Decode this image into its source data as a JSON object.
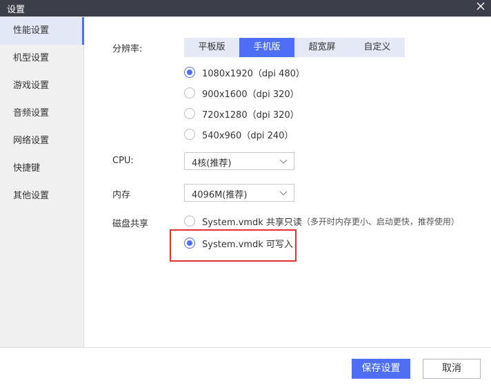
{
  "window": {
    "title": "设置"
  },
  "sidebar": {
    "items": [
      {
        "label": "性能设置",
        "active": true
      },
      {
        "label": "机型设置"
      },
      {
        "label": "游戏设置"
      },
      {
        "label": "音频设置"
      },
      {
        "label": "网络设置"
      },
      {
        "label": "快捷键"
      },
      {
        "label": "其他设置"
      }
    ]
  },
  "resolution": {
    "label": "分辨率:",
    "tabs": [
      {
        "label": "平板版"
      },
      {
        "label": "手机版",
        "active": true
      },
      {
        "label": "超宽屏"
      },
      {
        "label": "自定义"
      }
    ],
    "options": [
      {
        "label": "1080x1920（dpi 480）",
        "checked": true
      },
      {
        "label": "900x1600（dpi 320）"
      },
      {
        "label": "720x1280（dpi 320）"
      },
      {
        "label": "540x960（dpi 240）"
      }
    ]
  },
  "cpu": {
    "label": "CPU:",
    "value": "4核(推荐)"
  },
  "memory": {
    "label": "内存",
    "value": "4096M(推荐)"
  },
  "disk": {
    "label": "磁盘共享",
    "options": [
      {
        "label": "System.vmdk 共享只读",
        "note": "（多开时内存更小、启动更快，推荐使用）"
      },
      {
        "label": "System.vmdk 可写入",
        "checked": true
      }
    ]
  },
  "footer": {
    "save_label": "保存设置",
    "cancel_label": "取消"
  },
  "colors": {
    "accent": "#4d6ef5",
    "titlebar": "#3c3f4a",
    "highlight": "#e0322b",
    "sidebar_bg": "#f0f0f0",
    "sidebar_active": "#e2e8f5"
  }
}
